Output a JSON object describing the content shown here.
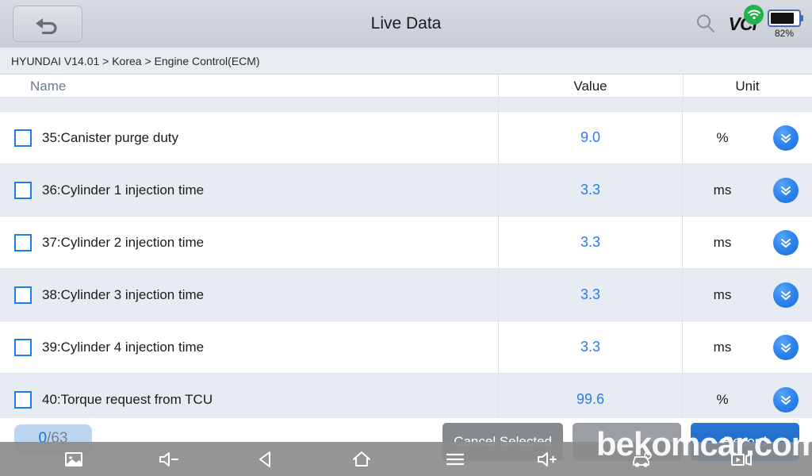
{
  "header": {
    "title": "Live Data",
    "back_icon": "back-arrow-icon",
    "search_icon": "search-icon",
    "vci_label": "VCI",
    "wifi_icon": "wifi-icon",
    "battery_percent": "82%"
  },
  "breadcrumb": {
    "text": "HYUNDAI V14.01 > Korea  > Engine Control(ECM)"
  },
  "table": {
    "columns": {
      "name": "Name",
      "value": "Value",
      "unit": "Unit"
    },
    "rows": [
      {
        "id": "35",
        "name": "35:Canister purge duty",
        "value": "9.0",
        "unit": "%",
        "checked": false
      },
      {
        "id": "36",
        "name": "36:Cylinder 1 injection time",
        "value": "3.3",
        "unit": "ms",
        "checked": false
      },
      {
        "id": "37",
        "name": "37:Cylinder 2 injection time",
        "value": "3.3",
        "unit": "ms",
        "checked": false
      },
      {
        "id": "38",
        "name": "38:Cylinder 3 injection time",
        "value": "3.3",
        "unit": "ms",
        "checked": false
      },
      {
        "id": "39",
        "name": "39:Cylinder 4 injection time",
        "value": "3.3",
        "unit": "ms",
        "checked": false
      },
      {
        "id": "40",
        "name": "40:Torque request from TCU",
        "value": "99.6",
        "unit": "%",
        "checked": false
      }
    ],
    "expand_icon": "double-chevron-down-icon"
  },
  "action_bar": {
    "counter_selected": "0",
    "counter_total": "/63",
    "cancel_selected_label": "Cancel Selected",
    "middle_label": "",
    "record_label": "Record"
  },
  "navbar": {
    "screenshot_icon": "screenshot-icon",
    "volume_down_icon": "volume-down-icon",
    "back_icon": "back-triangle-icon",
    "home_icon": "home-icon",
    "menu_icon": "menu-icon",
    "volume_up_icon": "volume-up-icon",
    "car_icon": "car-icon",
    "record_icon": "video-record-icon"
  },
  "watermark": {
    "text": "bekomcar.com"
  },
  "colors": {
    "accent_blue": "#2a7bf0",
    "checkbox_blue": "#1e7bf0",
    "row_alt": "#e7ebf2",
    "wifi_green": "#22b14c"
  }
}
